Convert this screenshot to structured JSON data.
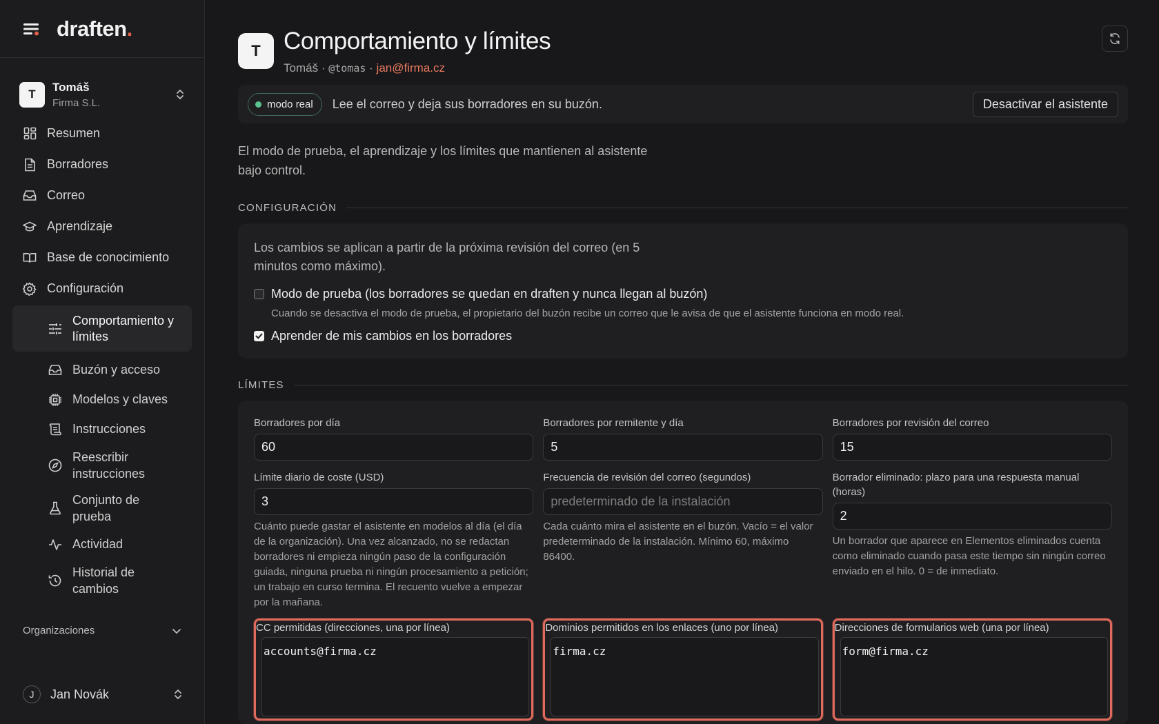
{
  "brand": {
    "name": "draften",
    "dot": "."
  },
  "account": {
    "initial": "T",
    "name": "Tomáš",
    "org": "Firma S.L."
  },
  "nav": [
    {
      "label": "Resumen",
      "icon": "dashboard-icon"
    },
    {
      "label": "Borradores",
      "icon": "document-icon"
    },
    {
      "label": "Correo",
      "icon": "inbox-icon"
    },
    {
      "label": "Aprendizaje",
      "icon": "graduation-cap-icon"
    },
    {
      "label": "Base de conocimiento",
      "icon": "book-icon"
    },
    {
      "label": "Configuración",
      "icon": "gear-icon"
    }
  ],
  "subnav": [
    {
      "label": "Comportamiento y límites",
      "icon": "sliders-icon",
      "active": true
    },
    {
      "label": "Buzón y acceso",
      "icon": "inbox-icon"
    },
    {
      "label": "Modelos y claves",
      "icon": "chip-icon"
    },
    {
      "label": "Instrucciones",
      "icon": "scroll-icon"
    },
    {
      "label": "Reescribir instrucciones",
      "icon": "compass-icon"
    },
    {
      "label": "Conjunto de prueba",
      "icon": "flask-icon"
    },
    {
      "label": "Actividad",
      "icon": "activity-icon"
    },
    {
      "label": "Historial de cambios",
      "icon": "history-icon"
    }
  ],
  "orgs_label": "Organizaciones",
  "user": {
    "initial": "J",
    "name": "Jan Novák"
  },
  "header": {
    "initial": "T",
    "title": "Comportamiento y límites",
    "name": "Tomáš",
    "sep": "·",
    "handle": "@tomas",
    "email": "jan@firma.cz"
  },
  "status": {
    "pill": "modo real",
    "description": "Lee el correo y deja sus borradores en su buzón.",
    "button": "Desactivar el asistente",
    "pill_color": "#5bc48e"
  },
  "intro": "El modo de prueba, el aprendizaje y los límites que mantienen al asistente bajo control.",
  "config": {
    "section": "CONFIGURACIÓN",
    "note": "Los cambios se aplican a partir de la próxima revisión del correo (en 5 minutos como máximo).",
    "test_mode": {
      "label": "Modo de prueba (los borradores se quedan en draften y nunca llegan al buzón)",
      "checked": false,
      "help": "Cuando se desactiva el modo de prueba, el propietario del buzón recibe un correo que le avisa de que el asistente funciona en modo real."
    },
    "learn": {
      "label": "Aprender de mis cambios en los borradores",
      "checked": true
    }
  },
  "limits": {
    "section": "LÍMITES",
    "per_day": {
      "label": "Borradores por día",
      "value": "60"
    },
    "per_sender": {
      "label": "Borradores por remitente y día",
      "value": "5"
    },
    "per_check": {
      "label": "Borradores por revisión del correo",
      "value": "15"
    },
    "cost": {
      "label": "Límite diario de coste (USD)",
      "value": "3",
      "help": "Cuánto puede gastar el asistente en modelos al día (el día de la organización). Una vez alcanzado, no se redactan borradores ni empieza ningún paso de la configuración guiada, ninguna prueba ni ningún procesamiento a petición; un trabajo en curso termina. El recuento vuelve a empezar por la mañana."
    },
    "frequency": {
      "label": "Frecuencia de revisión del correo (segundos)",
      "placeholder": "predeterminado de la instalación",
      "help": "Cada cuánto mira el asistente en el buzón. Vacío = el valor predeterminado de la instalación. Mínimo 60, máximo 86400."
    },
    "deleted": {
      "label": "Borrador eliminado: plazo para una respuesta manual (horas)",
      "value": "2",
      "help": "Un borrador que aparece en Elementos eliminados cuenta como eliminado cuando pasa este tiempo sin ningún correo enviado en el hilo. 0 = de inmediato."
    },
    "cc": {
      "label": "CC permitidas (direcciones, una por línea)",
      "value": "accounts@firma.cz"
    },
    "domains": {
      "label": "Dominios permitidos en los enlaces (uno por línea)",
      "value": "firma.cz"
    },
    "forms": {
      "label": "Direcciones de formularios web (una por línea)",
      "value": "form@firma.cz"
    }
  },
  "colors": {
    "accent": "#e8795f",
    "highlight": "#e06a5c"
  }
}
